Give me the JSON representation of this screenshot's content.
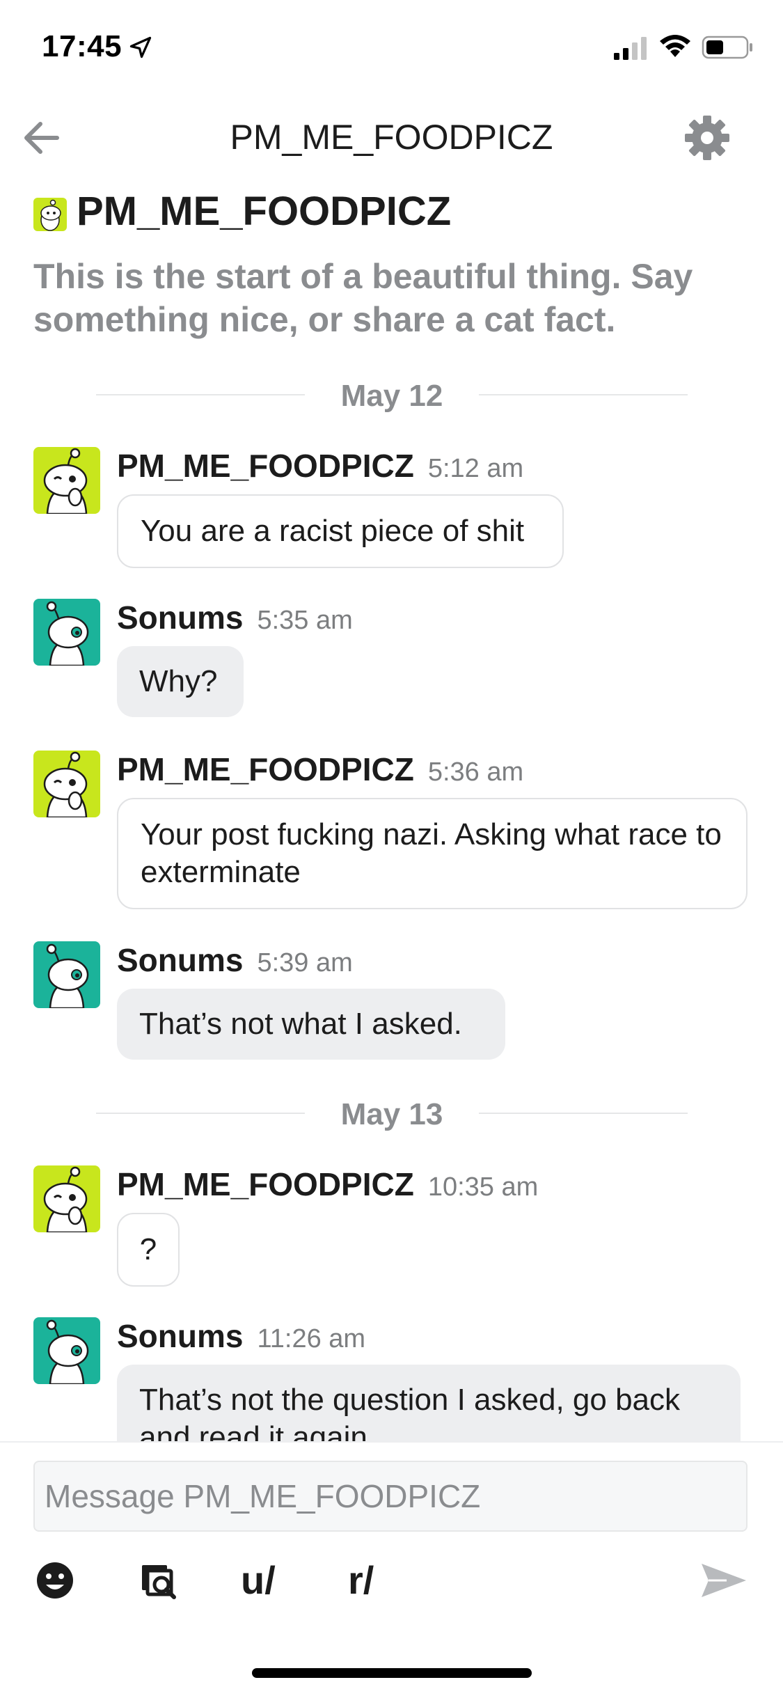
{
  "status_bar": {
    "time": "17:45"
  },
  "header": {
    "title": "PM_ME_FOODPICZ"
  },
  "intro": {
    "name": "PM_ME_FOODPICZ",
    "text": "This is the start of a beautiful thing. Say something nice, or share a cat fact."
  },
  "dates": [
    "May 12",
    "May 13"
  ],
  "messages": [
    {
      "sender": "PM_ME_FOODPICZ",
      "time": "5:12 am",
      "text": "You are a racist piece of shit"
    },
    {
      "sender": "Sonums",
      "time": "5:35 am",
      "text": "Why?"
    },
    {
      "sender": "PM_ME_FOODPICZ",
      "time": "5:36 am",
      "text": "Your post fucking nazi. Asking what race to exterminate"
    },
    {
      "sender": "Sonums",
      "time": "5:39 am",
      "text": "That’s not what I asked."
    },
    {
      "sender": "PM_ME_FOODPICZ",
      "time": "10:35 am",
      "text": "?"
    },
    {
      "sender": "Sonums",
      "time": "11:26 am",
      "text": "That’s not the question I asked, go back and read it again"
    }
  ],
  "composer": {
    "placeholder": "Message PM_ME_FOODPICZ",
    "user_label": "u/",
    "subreddit_label": "r/"
  },
  "colors": {
    "other_avatar": "#c8e61d",
    "me_avatar": "#1bb39a",
    "muted_text": "#8a8c8f"
  },
  "icons": [
    "location-arrow-icon",
    "signal-icon",
    "wifi-icon",
    "battery-icon",
    "back-arrow-icon",
    "gear-icon",
    "snoo-avatar-icon",
    "emoji-icon",
    "media-search-icon",
    "send-icon"
  ]
}
